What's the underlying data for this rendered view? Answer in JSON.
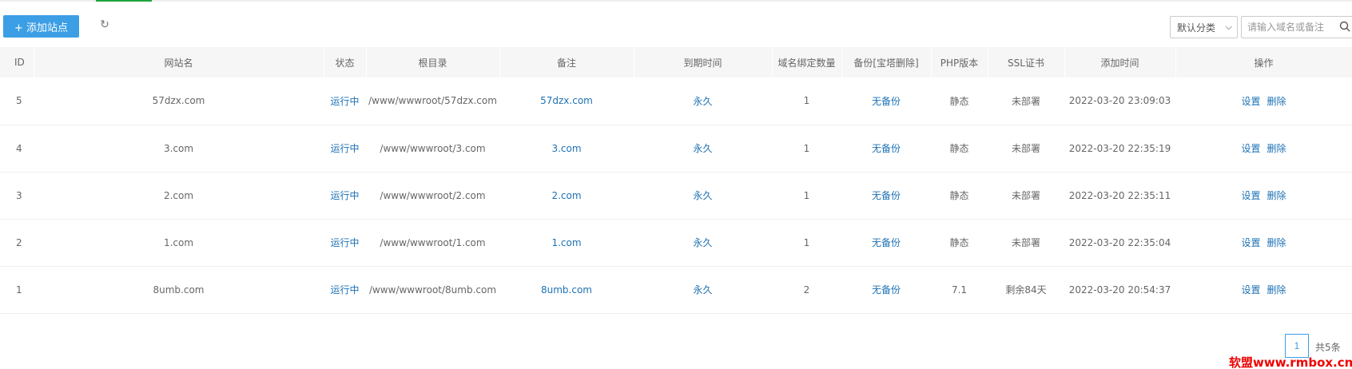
{
  "toolbar": {
    "add_label": "+ 添加站点",
    "refresh_icon": "refresh-icon",
    "category_selected": "默认分类",
    "search_placeholder": "请输入域名或备注"
  },
  "table": {
    "headers": [
      "ID",
      "网站名",
      "状态",
      "根目录",
      "备注",
      "到期时间",
      "域名绑定数量",
      "备份[宝塔删除]",
      "PHP版本",
      "SSL证书",
      "添加时间",
      "操作"
    ],
    "rows": [
      {
        "id": "5",
        "name": "57dzx.com",
        "status": "运行中",
        "root": "/www/wwwroot/57dzx.com",
        "note": "57dzx.com",
        "expire": "永久",
        "domains": "1",
        "backup": "无备份",
        "php": "静态",
        "ssl": "未部署",
        "added": "2022-03-20 23:09:03",
        "op_set": "设置",
        "op_del": "删除"
      },
      {
        "id": "4",
        "name": "3.com",
        "status": "运行中",
        "root": "/www/wwwroot/3.com",
        "note": "3.com",
        "expire": "永久",
        "domains": "1",
        "backup": "无备份",
        "php": "静态",
        "ssl": "未部署",
        "added": "2022-03-20 22:35:19",
        "op_set": "设置",
        "op_del": "删除"
      },
      {
        "id": "3",
        "name": "2.com",
        "status": "运行中",
        "root": "/www/wwwroot/2.com",
        "note": "2.com",
        "expire": "永久",
        "domains": "1",
        "backup": "无备份",
        "php": "静态",
        "ssl": "未部署",
        "added": "2022-03-20 22:35:11",
        "op_set": "设置",
        "op_del": "删除"
      },
      {
        "id": "2",
        "name": "1.com",
        "status": "运行中",
        "root": "/www/wwwroot/1.com",
        "note": "1.com",
        "expire": "永久",
        "domains": "1",
        "backup": "无备份",
        "php": "静态",
        "ssl": "未部署",
        "added": "2022-03-20 22:35:04",
        "op_set": "设置",
        "op_del": "删除"
      },
      {
        "id": "1",
        "name": "8umb.com",
        "status": "运行中",
        "root": "/www/wwwroot/8umb.com",
        "note": "8umb.com",
        "expire": "永久",
        "domains": "2",
        "backup": "无备份",
        "php": "7.1",
        "ssl": "剩余84天",
        "added": "2022-03-20 20:54:37",
        "op_set": "设置",
        "op_del": "删除"
      }
    ]
  },
  "pager": {
    "current": "1",
    "total_label": "共5条"
  },
  "watermark": "软盟www.rmbox.cn",
  "colors": {
    "accent": "#3c9ee5",
    "link": "#1e72b5",
    "header_bg": "#f6f6f6",
    "watermark": "#ee0000"
  }
}
